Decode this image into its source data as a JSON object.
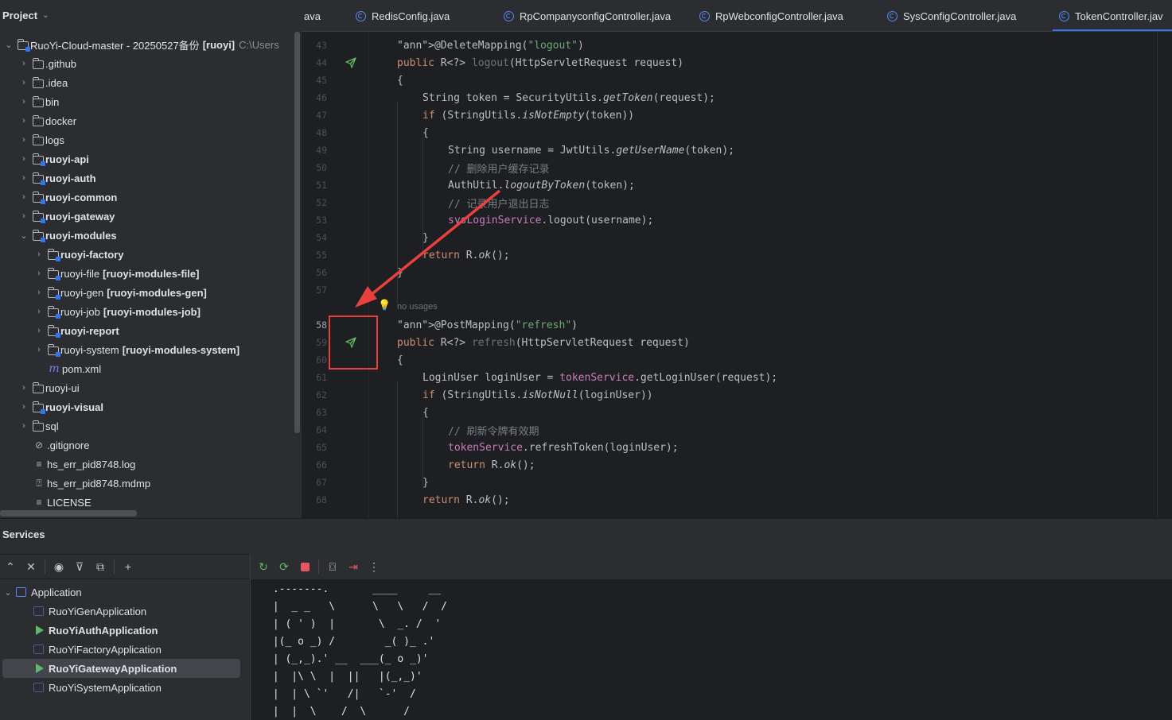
{
  "project": {
    "title": "Project",
    "tree": [
      {
        "arrow": "down",
        "icon": "module",
        "name": "RuoYi-Cloud-master - 20250527备份",
        "suffix": "[ruoyi]",
        "hint": "C:\\Users",
        "depth": 0
      },
      {
        "arrow": "right",
        "icon": "folder",
        "name": ".github",
        "depth": 1
      },
      {
        "arrow": "right",
        "icon": "folder",
        "name": ".idea",
        "depth": 1
      },
      {
        "arrow": "right",
        "icon": "folder",
        "name": "bin",
        "depth": 1
      },
      {
        "arrow": "right",
        "icon": "folder",
        "name": "docker",
        "depth": 1
      },
      {
        "arrow": "right",
        "icon": "folder",
        "name": "logs",
        "depth": 1
      },
      {
        "arrow": "right",
        "icon": "module",
        "name": "ruoyi-api",
        "depth": 1,
        "bold": true
      },
      {
        "arrow": "right",
        "icon": "module",
        "name": "ruoyi-auth",
        "depth": 1,
        "bold": true
      },
      {
        "arrow": "right",
        "icon": "module",
        "name": "ruoyi-common",
        "depth": 1,
        "bold": true
      },
      {
        "arrow": "right",
        "icon": "module",
        "name": "ruoyi-gateway",
        "depth": 1,
        "bold": true
      },
      {
        "arrow": "down",
        "icon": "module",
        "name": "ruoyi-modules",
        "depth": 1,
        "bold": true
      },
      {
        "arrow": "right",
        "icon": "module",
        "name": "ruoyi-factory",
        "depth": 2,
        "bold": true
      },
      {
        "arrow": "right",
        "icon": "module",
        "name": "ruoyi-file",
        "suffix": "[ruoyi-modules-file]",
        "depth": 2
      },
      {
        "arrow": "right",
        "icon": "module",
        "name": "ruoyi-gen",
        "suffix": "[ruoyi-modules-gen]",
        "depth": 2
      },
      {
        "arrow": "right",
        "icon": "module",
        "name": "ruoyi-job",
        "suffix": "[ruoyi-modules-job]",
        "depth": 2
      },
      {
        "arrow": "right",
        "icon": "module",
        "name": "ruoyi-report",
        "depth": 2,
        "bold": true
      },
      {
        "arrow": "right",
        "icon": "module",
        "name": "ruoyi-system",
        "suffix": "[ruoyi-modules-system]",
        "depth": 2
      },
      {
        "arrow": "",
        "icon": "maven",
        "name": "pom.xml",
        "depth": 2
      },
      {
        "arrow": "right",
        "icon": "folder",
        "name": "ruoyi-ui",
        "depth": 1
      },
      {
        "arrow": "right",
        "icon": "module",
        "name": "ruoyi-visual",
        "depth": 1,
        "bold": true
      },
      {
        "arrow": "right",
        "icon": "folder",
        "name": "sql",
        "depth": 1
      },
      {
        "arrow": "",
        "icon": "ignore",
        "name": ".gitignore",
        "depth": 1
      },
      {
        "arrow": "",
        "icon": "text",
        "name": "hs_err_pid8748.log",
        "depth": 1
      },
      {
        "arrow": "",
        "icon": "unknown",
        "name": "hs_err_pid8748.mdmp",
        "depth": 1
      },
      {
        "arrow": "",
        "icon": "text",
        "name": "LICENSE",
        "depth": 1
      }
    ]
  },
  "tabs": [
    {
      "label": "ava",
      "icon": false
    },
    {
      "label": "RedisConfig.java",
      "icon": true
    },
    {
      "label": "RpCompanyconfigController.java",
      "icon": true
    },
    {
      "label": "RpWebconfigController.java",
      "icon": true
    },
    {
      "label": "SysConfigController.java",
      "icon": true
    },
    {
      "label": "TokenController.jav",
      "icon": true,
      "active": true
    }
  ],
  "editor": {
    "no_usages_hint": "no usages",
    "lines": [
      {
        "n": "43",
        "text": "@DeleteMapping(\"logout\")"
      },
      {
        "n": "44",
        "text": "public R<?> logout(HttpServletRequest request)"
      },
      {
        "n": "45",
        "text": "{"
      },
      {
        "n": "46",
        "text": "String token = SecurityUtils.getToken(request);"
      },
      {
        "n": "47",
        "text": "if (StringUtils.isNotEmpty(token))"
      },
      {
        "n": "48",
        "text": "{"
      },
      {
        "n": "49",
        "text": "String username = JwtUtils.getUserName(token);"
      },
      {
        "n": "50",
        "text": "// 删除用户缓存记录"
      },
      {
        "n": "51",
        "text": "AuthUtil.logoutByToken(token);"
      },
      {
        "n": "52",
        "text": "// 记录用户退出日志"
      },
      {
        "n": "53",
        "text": "sysLoginService.logout(username);"
      },
      {
        "n": "54",
        "text": "}"
      },
      {
        "n": "55",
        "text": "return R.ok();"
      },
      {
        "n": "56",
        "text": "}"
      },
      {
        "n": "57",
        "text": ""
      },
      {
        "n": "58",
        "text": "@PostMapping(\"refresh\")"
      },
      {
        "n": "59",
        "text": "public R<?> refresh(HttpServletRequest request)"
      },
      {
        "n": "60",
        "text": "{"
      },
      {
        "n": "61",
        "text": "LoginUser loginUser = tokenService.getLoginUser(request);"
      },
      {
        "n": "62",
        "text": "if (StringUtils.isNotNull(loginUser))"
      },
      {
        "n": "63",
        "text": "{"
      },
      {
        "n": "64",
        "text": "// 刷新令牌有效期"
      },
      {
        "n": "65",
        "text": "tokenService.refreshToken(loginUser);"
      },
      {
        "n": "66",
        "text": "return R.ok();"
      },
      {
        "n": "67",
        "text": "}"
      },
      {
        "n": "68",
        "text": "return R.ok();"
      }
    ]
  },
  "services": {
    "title": "Services",
    "root": "Application",
    "apps": [
      {
        "name": "RuoYiGenApplication",
        "running": false
      },
      {
        "name": "RuoYiAuthApplication",
        "running": true
      },
      {
        "name": "RuoYiFactoryApplication",
        "running": false
      },
      {
        "name": "RuoYiGatewayApplication",
        "running": true,
        "selected": true
      },
      {
        "name": "RuoYiSystemApplication",
        "running": false
      }
    ],
    "console": " .-------.       ____     __\n |  _ _   \\      \\   \\   /  /\n | ( ' )  |       \\  _. /  '\n |(_ o _) /        _( )_ .'\n | (_,_).' __  ___(_ o _)'\n |  |\\ \\  |  ||   |(_,_)'\n |  | \\ `'   /|   `-'  /\n |  |  \\    /  \\      /"
  },
  "colors": {
    "accent": "#3574f0",
    "highlight_red": "#e8403d",
    "run_green": "#5fb865"
  }
}
